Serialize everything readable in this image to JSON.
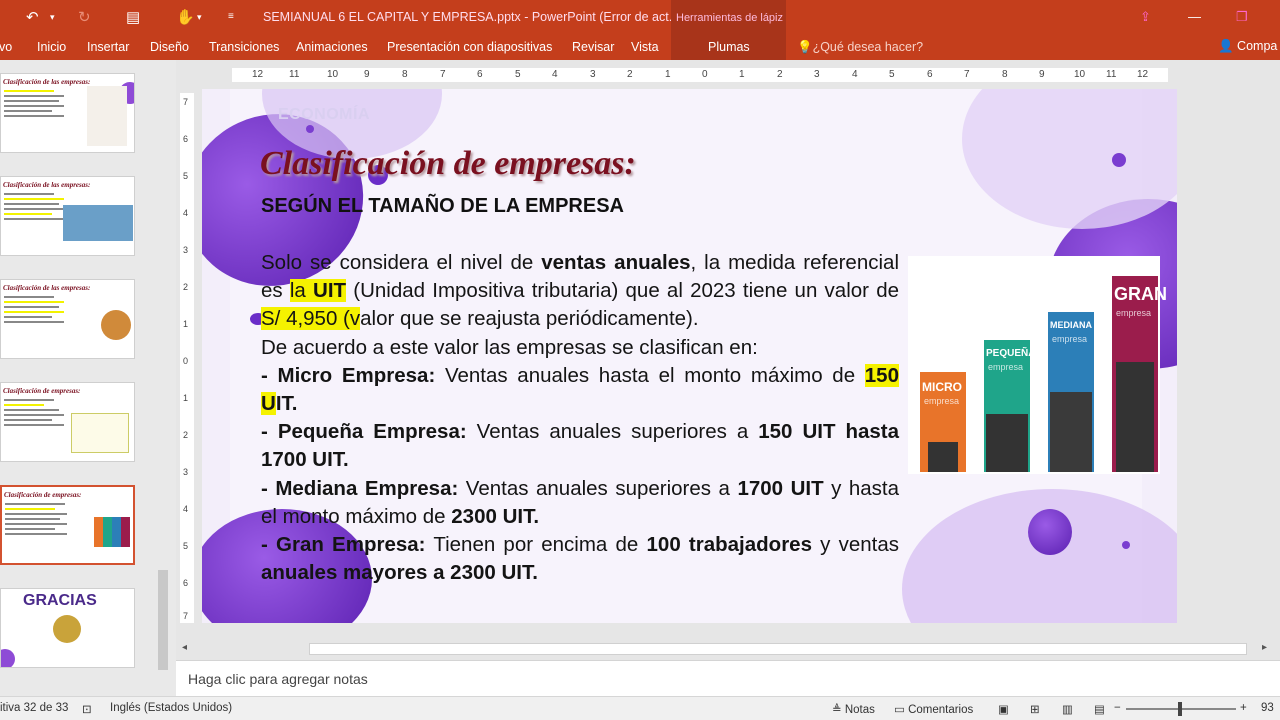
{
  "titlebar": {
    "document_title": "SEMIANUAL 6 EL CAPITAL Y EMPRESA.pptx - PowerPoint (Error de act...",
    "contextual_group": "Herramientas de lápiz",
    "undo_icon": "undo-icon",
    "redo_icon": "redo-icon",
    "slideshow_icon": "present-icon",
    "touch_icon": "touch-mode-icon",
    "customize_icon": "customize-icon"
  },
  "ribbon": {
    "tabs": [
      "vo",
      "Inicio",
      "Insertar",
      "Diseño",
      "Transiciones",
      "Animaciones",
      "Presentación con diapositivas",
      "Revisar",
      "Vista"
    ],
    "contextual_tab": "Plumas",
    "tell_me": "¿Qué desea hacer?",
    "share": "Compa"
  },
  "ruler": {
    "horizontal": [
      "12",
      "11",
      "10",
      "9",
      "8",
      "7",
      "6",
      "5",
      "4",
      "3",
      "2",
      "1",
      "0",
      "1",
      "2",
      "3",
      "4",
      "5",
      "6",
      "7",
      "8",
      "9",
      "10",
      "11",
      "12"
    ],
    "vertical": [
      "7",
      "6",
      "5",
      "4",
      "3",
      "2",
      "1",
      "0",
      "1",
      "2",
      "3",
      "4",
      "5",
      "6",
      "7"
    ]
  },
  "thumbnails": {
    "gracias_label": "GRACIAS",
    "items": [
      {
        "title": "Clasificación de las empresas:"
      },
      {
        "title": "Clasificación de las empresas:"
      },
      {
        "title": "Clasificación de las empresas:"
      },
      {
        "title": "Clasificación de empresas:"
      },
      {
        "title": "Clasificación de empresas:"
      }
    ]
  },
  "slide": {
    "header_label": "ECONOMÍA",
    "title": "Clasificación de empresas:",
    "subtitle": "SEGÚN EL TAMAÑO DE LA EMPRESA",
    "p1_a": "Solo se considera el nivel de ",
    "p1_b": "ventas anuales",
    "p1_c": ", la medida referencial es ",
    "p1_d": "la ",
    "p1_e": "UIT",
    "p1_f": " (Unidad Impositiva tributaria) que al 2023 tiene un valor de ",
    "p1_g": "S/ 4,950 (v",
    "p1_h": "alor que se reajusta periódicamente).",
    "p2": "De acuerdo a este valor las empresas se clasifican en:",
    "micro_label": "- Micro Empresa:",
    "micro_text": " Ventas anuales hasta el monto máximo de ",
    "micro_val_hl": "150 U",
    "micro_val_rest": "IT.",
    "peq_label": "- Pequeña Empresa:",
    "peq_text": " Ventas anuales superiores a ",
    "peq_val": "150 UIT hasta 1700 UIT.",
    "med_label": "- Mediana Empresa:",
    "med_text": " Ventas anuales superiores a ",
    "med_val1": "1700 UIT",
    "med_text2": " y hasta el monto máximo de ",
    "med_val2": "2300 UIT.",
    "gran_label": "- Gran Empresa:",
    "gran_text": " Tienen por encima de ",
    "gran_val1": "100 trabajadores",
    "gran_text2": " y ventas ",
    "gran_val2": "anuales mayores a 2300 UIT."
  },
  "picture": {
    "buildings": [
      {
        "label": "MICRO",
        "sub": "empresa",
        "color": "#e8742a"
      },
      {
        "label": "PEQUEÑA",
        "sub": "empresa",
        "color": "#1fa58a"
      },
      {
        "label": "MEDIANA",
        "sub": "empresa",
        "color": "#2c7fb8"
      },
      {
        "label": "GRAN",
        "sub": "empresa",
        "color": "#9b1d4c"
      }
    ]
  },
  "notes": {
    "placeholder": "Haga clic para agregar notas"
  },
  "status": {
    "slide_counter": "itiva 32 de 33",
    "language": "Inglés (Estados Unidos)",
    "notes_btn": "Notas",
    "comments_btn": "Comentarios",
    "zoom": "93"
  },
  "colors": {
    "accent": "#c43e1c",
    "title_red": "#7a1020",
    "highlight": "#f5f200",
    "blob_purple": "#7d3fd0"
  }
}
